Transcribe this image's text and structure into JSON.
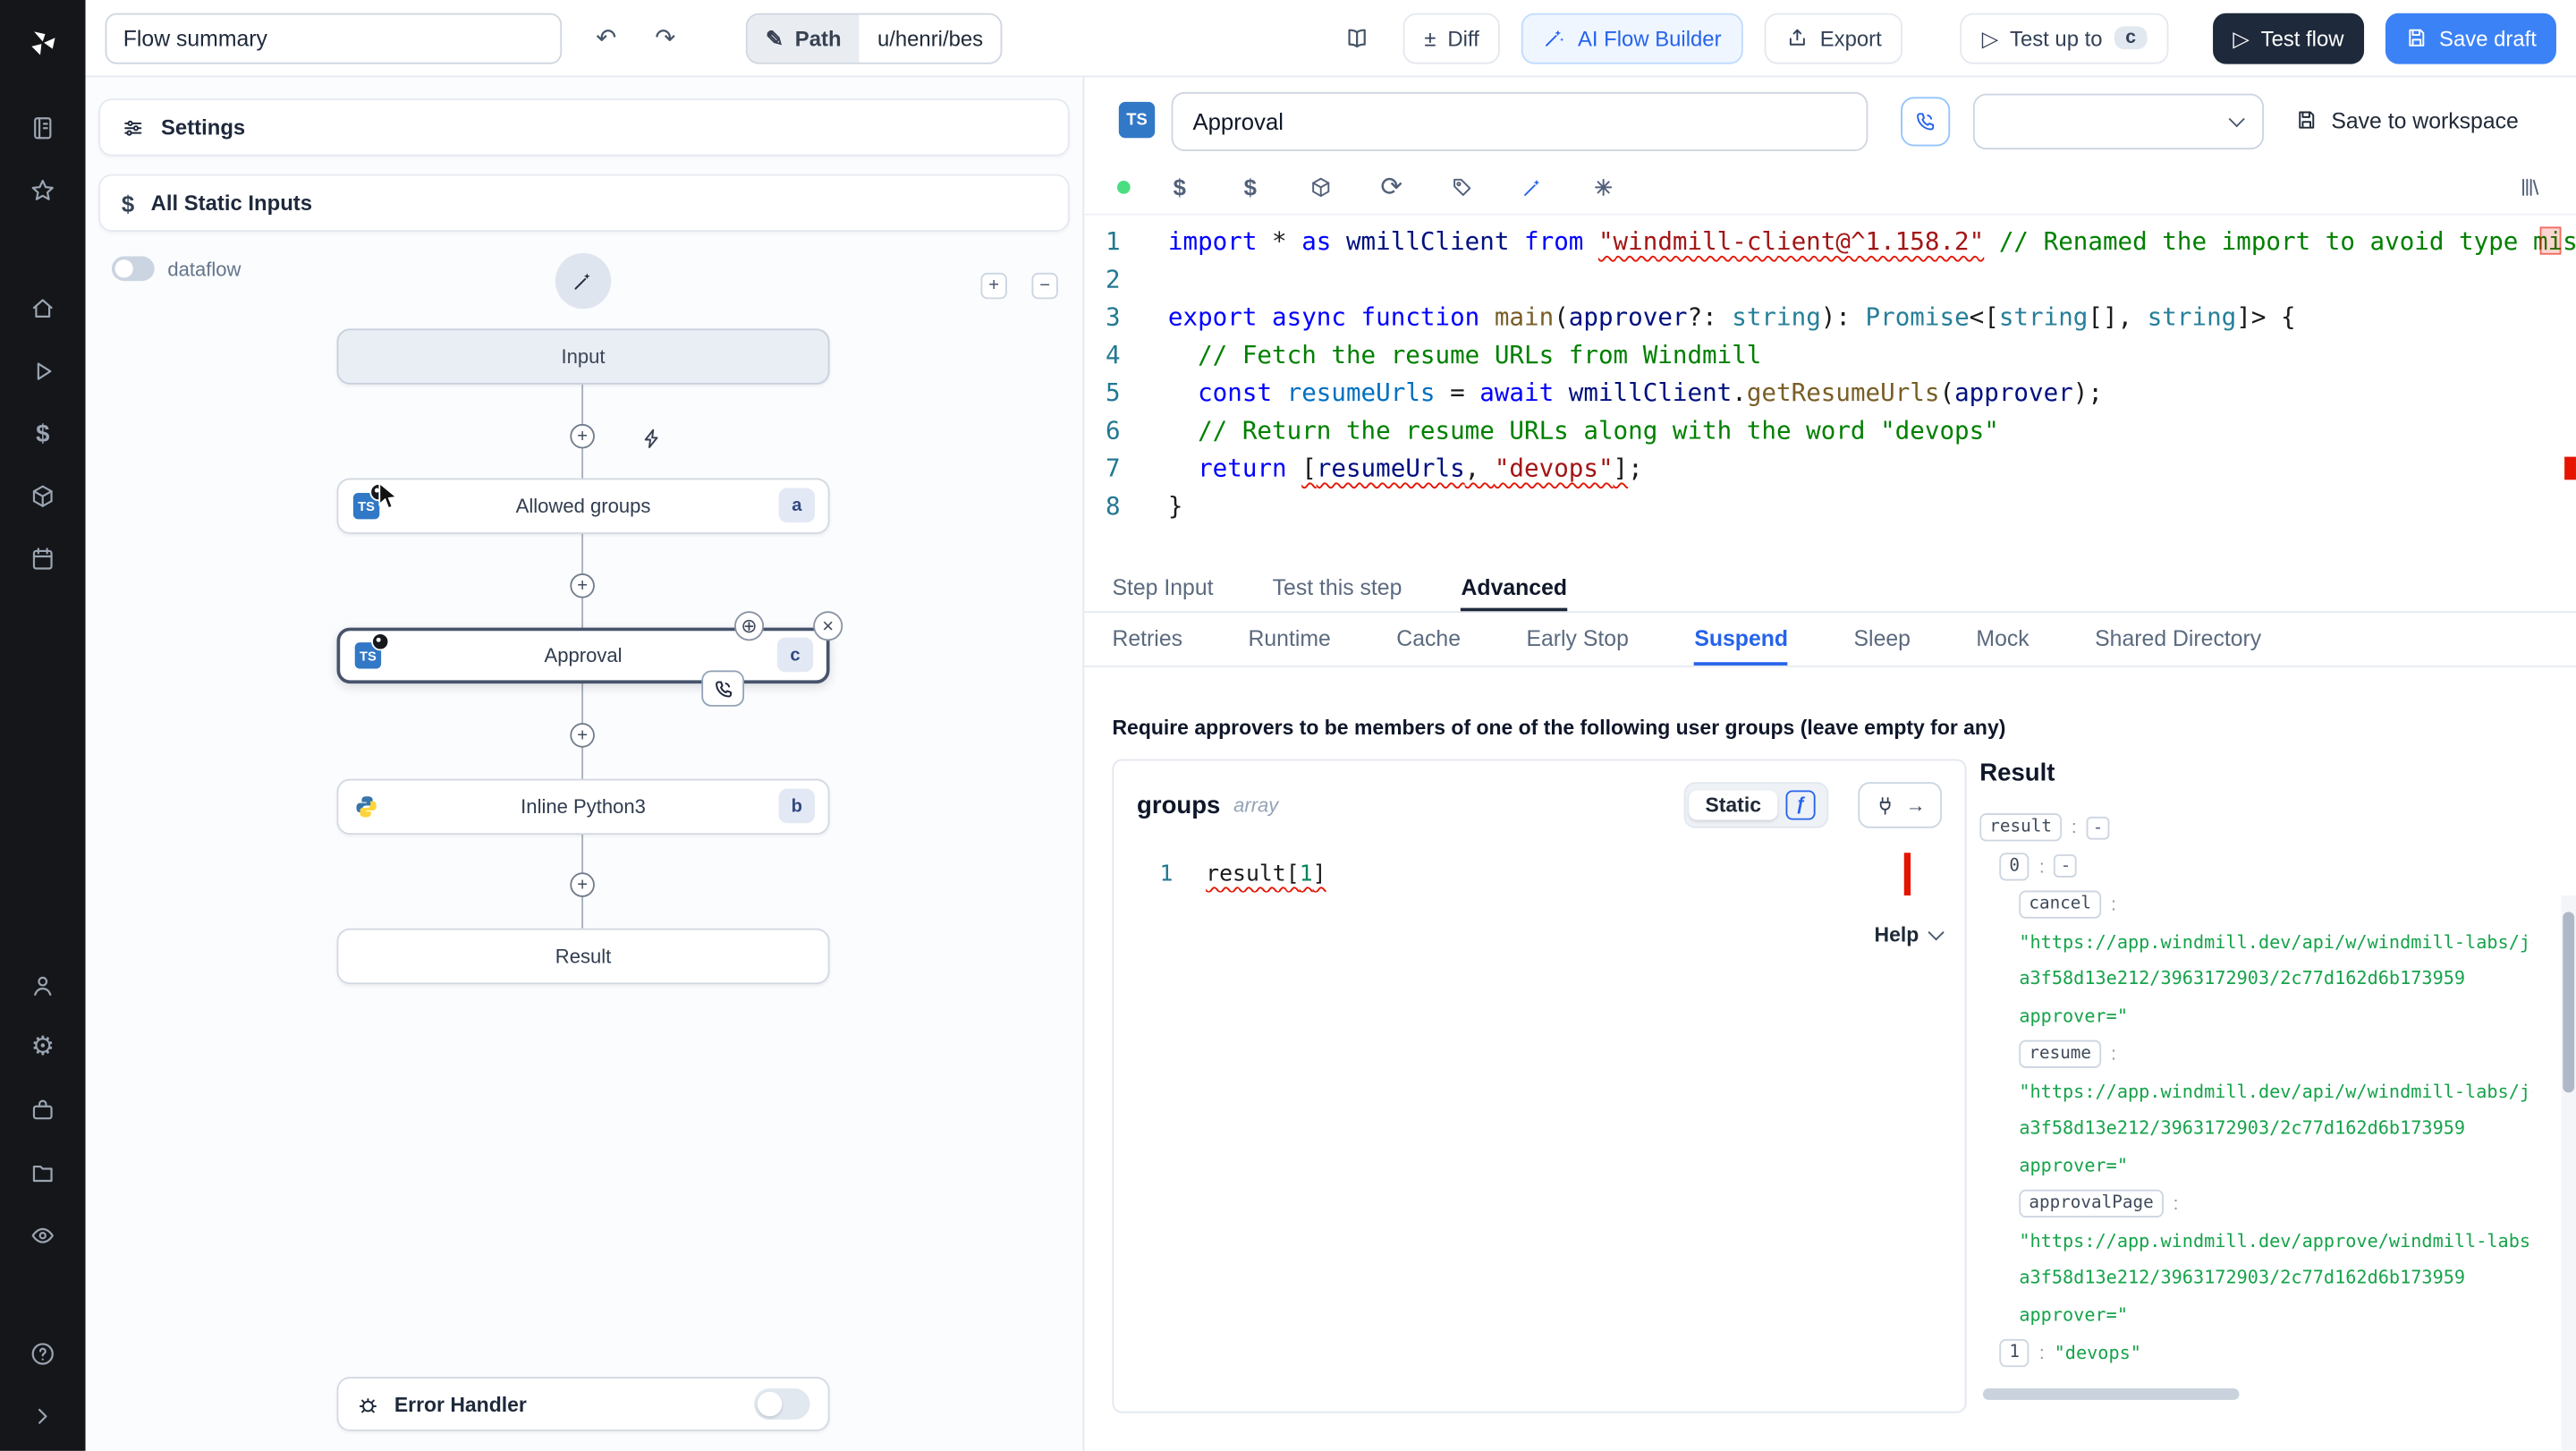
{
  "glyphs": {
    "undo": "↶",
    "redo": "↷",
    "pencil": "✎",
    "diff": "±",
    "play": "▷",
    "dollar": "$",
    "refresh": "⟳",
    "gear": "⚙",
    "plus": "+",
    "minus": "−",
    "close": "×",
    "move_handle": "⊕",
    "arrow_right": "→",
    "fx": "ƒ",
    "question": "?",
    "home": "⌂",
    "dash": "-"
  },
  "topbar": {
    "flow_summary_value": "Flow summary",
    "path_label": "Path",
    "path_value": "u/henri/bes",
    "diff_label": "Diff",
    "ai_builder_label": "AI Flow Builder",
    "export_label": "Export",
    "test_up_to_label": "Test up to",
    "test_up_to_badge": "c",
    "test_flow_label": "Test flow",
    "save_draft_label": "Save draft"
  },
  "flow_panel": {
    "settings_label": "Settings",
    "all_static_inputs_label": "All Static Inputs",
    "dataflow_label": "dataflow",
    "error_handler_label": "Error Handler",
    "graph": {
      "input_label": "Input",
      "result_label": "Result",
      "steps": [
        {
          "label": "Allowed groups",
          "badge": "a",
          "lang_abbr": "TS"
        },
        {
          "label": "Approval",
          "badge": "c",
          "lang_abbr": "TS"
        },
        {
          "label": "Inline Python3",
          "badge": "b",
          "lang": "python"
        }
      ]
    }
  },
  "step_editor": {
    "lang_badge": "TS",
    "step_name_value": "Approval",
    "save_to_workspace_label": "Save to workspace",
    "code_lines": [
      {
        "no": "1",
        "tokens": [
          [
            "kw",
            "import"
          ],
          [
            "pl",
            " * "
          ],
          [
            "kw",
            "as"
          ],
          [
            "pl",
            " "
          ],
          [
            "vr",
            "wmillClient"
          ],
          [
            "pl",
            " "
          ],
          [
            "kw",
            "from"
          ],
          [
            "pl",
            " "
          ],
          [
            "st sq",
            "\"windmill-client@^1.158.2\""
          ],
          [
            "pl",
            " "
          ],
          [
            "cm",
            "// Renamed the import to avoid type mismatch"
          ]
        ]
      },
      {
        "no": "2",
        "tokens": []
      },
      {
        "no": "3",
        "tokens": [
          [
            "kw",
            "export"
          ],
          [
            "pl",
            " "
          ],
          [
            "kw",
            "async"
          ],
          [
            "pl",
            " "
          ],
          [
            "kw",
            "function"
          ],
          [
            "pl",
            " "
          ],
          [
            "fn",
            "main"
          ],
          [
            "pl",
            "("
          ],
          [
            "vr",
            "approver"
          ],
          [
            "pl",
            "?: "
          ],
          [
            "ty",
            "string"
          ],
          [
            "pl",
            "): "
          ],
          [
            "ty",
            "Promise"
          ],
          [
            "pl",
            "<["
          ],
          [
            "ty",
            "string"
          ],
          [
            "pl",
            "[], "
          ],
          [
            "ty",
            "string"
          ],
          [
            "pl",
            "]> {"
          ]
        ]
      },
      {
        "no": "4",
        "tokens": [
          [
            "cm",
            "  // Fetch the resume URLs from Windmill"
          ]
        ]
      },
      {
        "no": "5",
        "tokens": [
          [
            "pl",
            "  "
          ],
          [
            "kw",
            "const"
          ],
          [
            "pl",
            " "
          ],
          [
            "cv",
            "resumeUrls"
          ],
          [
            "pl",
            " = "
          ],
          [
            "kw",
            "await"
          ],
          [
            "pl",
            " "
          ],
          [
            "vr",
            "wmillClient"
          ],
          [
            "pl",
            "."
          ],
          [
            "fn",
            "getResumeUrls"
          ],
          [
            "pl",
            "("
          ],
          [
            "vr",
            "approver"
          ],
          [
            "pl",
            ");"
          ]
        ]
      },
      {
        "no": "6",
        "tokens": [
          [
            "cm",
            "  // Return the resume URLs along with the word \"devops\""
          ]
        ]
      },
      {
        "no": "7",
        "tokens": [
          [
            "pl",
            "  "
          ],
          [
            "kw",
            "return"
          ],
          [
            "pl",
            " "
          ],
          [
            "pl sq",
            "["
          ],
          [
            "vr sq",
            "resumeUrls"
          ],
          [
            "pl sq",
            ", "
          ],
          [
            "st sq",
            "\"devops\""
          ],
          [
            "pl sq",
            "]"
          ],
          [
            "pl",
            ";"
          ]
        ]
      },
      {
        "no": "8",
        "tokens": [
          [
            "pl",
            "}"
          ]
        ]
      }
    ]
  },
  "tabs": {
    "step_input": "Step Input",
    "test_this_step": "Test this step",
    "advanced": "Advanced"
  },
  "advanced_tabs": {
    "retries": "Retries",
    "runtime": "Runtime",
    "cache": "Cache",
    "early_stop": "Early Stop",
    "suspend": "Suspend",
    "sleep": "Sleep",
    "mock": "Mock",
    "shared_directory": "Shared Directory"
  },
  "suspend_form": {
    "description": "Require approvers to be members of one of the following user groups (leave empty for any)",
    "field_name": "groups",
    "field_type": "array",
    "static_label": "Static",
    "expr_line_no": "1",
    "expr_tokens": [
      [
        "pl sq",
        "result"
      ],
      [
        "pl sq",
        "["
      ],
      [
        "nu sq",
        "1"
      ],
      [
        "pl sq",
        "]"
      ]
    ],
    "help_label": "Help"
  },
  "result_panel": {
    "title": "Result",
    "items": [
      {
        "key": "result",
        "dash": "-",
        "indent": 0
      },
      {
        "key": "0",
        "dash": "-",
        "indent": 1
      },
      {
        "key": "cancel",
        "indent": 2,
        "lines": [
          "\"https://app.windmill.dev/api/w/windmill-labs/jobs",
          "a3f58d13e212/3963172903/2c77d162d6b173959",
          "approver=\""
        ]
      },
      {
        "key": "resume",
        "indent": 2,
        "lines": [
          "\"https://app.windmill.dev/api/w/windmill-labs/jobs",
          "a3f58d13e212/3963172903/2c77d162d6b173959",
          "approver=\""
        ]
      },
      {
        "key": "approvalPage",
        "indent": 2,
        "lines": [
          "\"https://app.windmill.dev/approve/windmill-labs/C",
          "a3f58d13e212/3963172903/2c77d162d6b173959",
          "approver=\""
        ]
      },
      {
        "key": "1",
        "indent": 1,
        "value": "\"devops\""
      }
    ]
  }
}
